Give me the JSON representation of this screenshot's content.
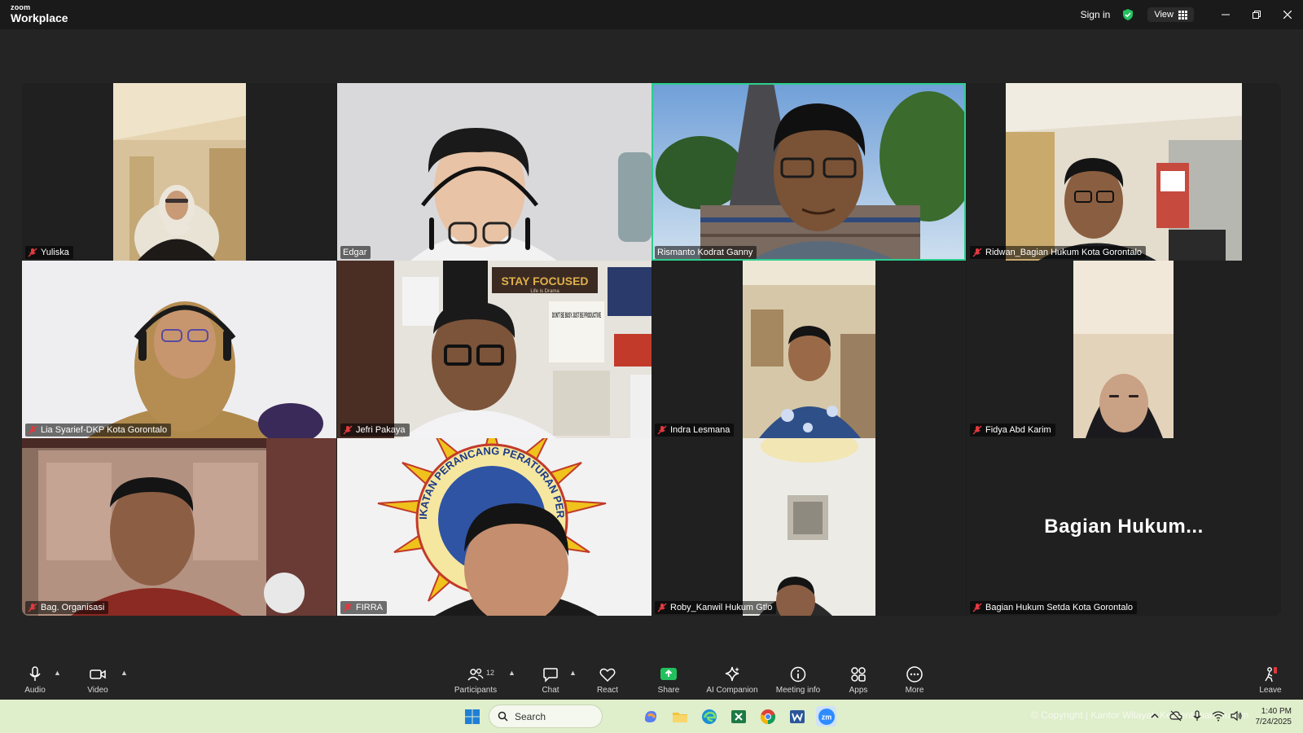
{
  "app": {
    "logo_top": "zoom",
    "logo_bottom": "Workplace"
  },
  "titlebar": {
    "sign_in": "Sign in",
    "view": "View"
  },
  "participants": [
    {
      "name": "Yuliska"
    },
    {
      "name": "Edgar"
    },
    {
      "name": "Rismanto Kodrat Ganny"
    },
    {
      "name": "Ridwan_Bagian Hukum Kota Gorontalo"
    },
    {
      "name": "Lia Syarief-DKP Kota Gorontalo"
    },
    {
      "name": "Jefri Pakaya"
    },
    {
      "name": "Indra Lesmana"
    },
    {
      "name": "Fidya Abd Karim"
    },
    {
      "name": "Bag. Organisasi"
    },
    {
      "name": "FIRRA"
    },
    {
      "name": "Roby_Kanwil Hukum Gtlo"
    },
    {
      "name": "Bagian Hukum Setda Kota Gorontalo",
      "display": "Bagian  Hukum..."
    }
  ],
  "background_text": {
    "poster_title": "STAY FOCUSED",
    "poster_sub": "Life is Drama",
    "poster_main": "DON'T BE BUSY JUST BE PRODUCTIVE",
    "logo_ring": "IKATAN PERANCANG PERATURAN PERUNDANG-UNDANGAN"
  },
  "toolbar": {
    "audio": "Audio",
    "video": "Video",
    "participants": "Participants",
    "participants_count": "12",
    "chat": "Chat",
    "react": "React",
    "share": "Share",
    "ai_companion": "AI Companion",
    "meeting_info": "Meeting info",
    "apps": "Apps",
    "more": "More",
    "leave": "Leave"
  },
  "taskbar": {
    "search": "Search",
    "watermark": "© Copyright | Kantor Wilayah Kementerian Hukum",
    "time": "1:40 PM",
    "date": "7/24/2025"
  },
  "colors": {
    "active_speaker": "#2bcf8e",
    "share_green": "#22c15e",
    "mute_red": "#e0393e"
  }
}
